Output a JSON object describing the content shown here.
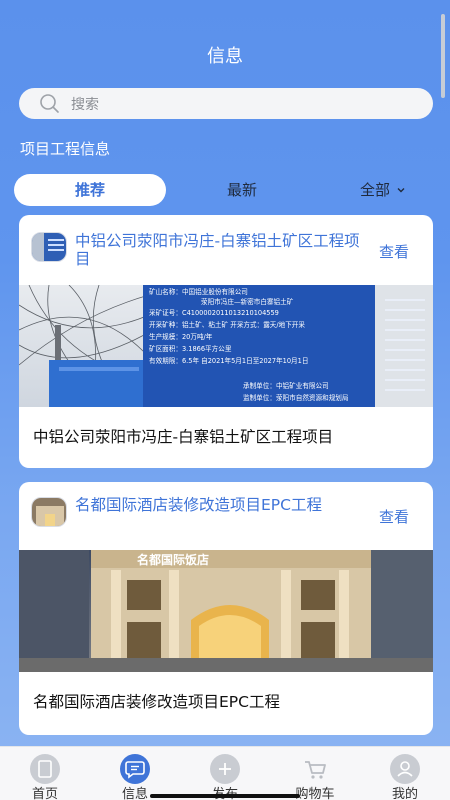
{
  "header": {
    "title": "信息"
  },
  "search": {
    "placeholder": "搜索"
  },
  "section": {
    "label": "项目工程信息"
  },
  "tabs": [
    {
      "label": "推荐",
      "active": true
    },
    {
      "label": "最新",
      "active": false
    },
    {
      "label": "全部",
      "active": false
    }
  ],
  "cards": [
    {
      "title": "中铝公司荥阳市冯庄-白寨铝土矿区工程项目",
      "view": "查看",
      "caption": "中铝公司荥阳市冯庄-白寨铝土矿区工程项目",
      "sign_lines": [
        "矿山名称：中国铝业股份有限公司",
        "荥阳市冯庄—新密市白寨铝土矿",
        "采矿证号：C4100002011013210104559",
        "开采矿种：铝土矿、粘土矿 开采方式：露天/地下开采",
        "生产规模：20万吨/年",
        "矿区面积：3.1866平方公里",
        "有效期限：6.5年   自2021年5月1日至2027年10月1日",
        "承制单位：中铝矿业有限公司",
        "监制单位：荥阳市自然资源和规划局"
      ]
    },
    {
      "title": "名都国际酒店装修改造项目EPC工程",
      "view": "查看",
      "caption": "名都国际酒店装修改造项目EPC工程",
      "sign_text": "名都国际饭店"
    }
  ],
  "tabbar": [
    {
      "label": "首页",
      "icon": "document-icon",
      "active": false
    },
    {
      "label": "信息",
      "icon": "message-icon",
      "active": true
    },
    {
      "label": "发布",
      "icon": "plus-icon",
      "active": false
    },
    {
      "label": "购物车",
      "icon": "cart-icon",
      "active": false
    },
    {
      "label": "我的",
      "icon": "user-icon",
      "active": false
    }
  ],
  "colors": {
    "accent": "#3f74d8",
    "header_bg": "#5b91ec"
  }
}
